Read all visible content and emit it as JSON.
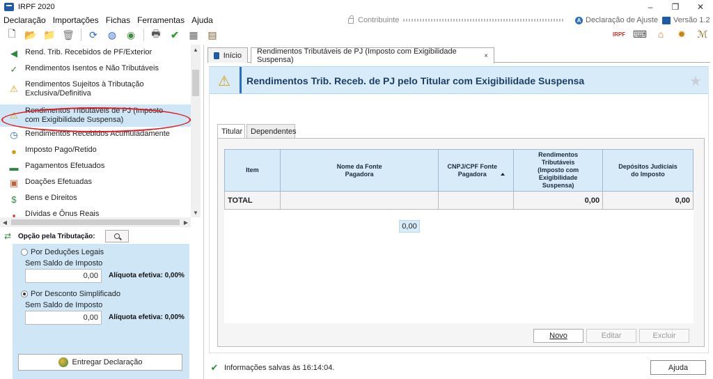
{
  "window": {
    "title": "IRPF 2020",
    "controls": {
      "minimize": "–",
      "restore": "❐",
      "close": "✕"
    }
  },
  "menu": [
    "Declaração",
    "Importações",
    "Fichas",
    "Ferramentas",
    "Ajuda"
  ],
  "header_info": {
    "contribuinte_label": "Contribuinte",
    "declaracao": "Declaração de Ajuste",
    "versao": "Versão 1.2"
  },
  "toolbar": {
    "icons": [
      "new-file-icon",
      "open-folder-icon",
      "folder-icon",
      "trash-icon",
      "globe-arrows-icon",
      "globe-search-icon",
      "globe-icon",
      "print-icon",
      "check-icon",
      "calculator-icon",
      "report-icon"
    ],
    "right_icons": [
      "irpf-icon",
      "keyboard-icon",
      "home-icon",
      "receita-seal-icon",
      "help-m-icon"
    ]
  },
  "nav": {
    "items": [
      {
        "label": "Rend. Trib. Recebidos de PF/Exterior",
        "icon": "money-arrow-icon"
      },
      {
        "label": "Rendimentos Isentos e Não Tributáveis",
        "icon": "shield-check-icon"
      },
      {
        "label": "Rendimentos Sujeitos à Tributação Exclusiva/Definitiva",
        "icon": "warning-icon"
      },
      {
        "label": "Rendimentos Tributáveis de PJ (Imposto com Exigibilidade Suspensa)",
        "icon": "money-warning-icon",
        "selected": true
      },
      {
        "label": "Rendimentos Recebidos Acumuladamente",
        "icon": "money-clock-icon"
      },
      {
        "label": "Imposto Pago/Retido",
        "icon": "coin-hand-icon"
      },
      {
        "label": "Pagamentos Efetuados",
        "icon": "banknote-icon"
      },
      {
        "label": "Doações Efetuadas",
        "icon": "donation-icon"
      },
      {
        "label": "Bens e Direitos",
        "icon": "dollar-box-icon"
      },
      {
        "label": "Dívidas e Ônus Reais",
        "icon": "debt-icon"
      }
    ]
  },
  "tributacao": {
    "label": "Opção pela Tributação:",
    "deducoes": {
      "label": "Por Deduções Legais",
      "sub": "Sem Saldo de Imposto",
      "value": "0,00",
      "aliquota": "Alíquota efetiva: 0,00%"
    },
    "simplificado": {
      "label": "Por Desconto Simplificado",
      "sub": "Sem Saldo de Imposto",
      "value": "0,00",
      "aliquota": "Alíquota efetiva: 0,00%"
    },
    "entregar": "Entregar Declaração"
  },
  "tabs": [
    {
      "label": "Início"
    },
    {
      "label": "Rendimentos Tributáveis de PJ (Imposto com Exigibilidade Suspensa)",
      "close": "×"
    }
  ],
  "page": {
    "title": "Rendimentos Trib. Receb. de PJ pelo Titular com Exigibilidade Suspensa",
    "star": "★"
  },
  "inner_tabs": [
    "Titular",
    "Dependentes"
  ],
  "grid": {
    "columns": [
      "Item",
      "Nome da Fonte Pagadora",
      "CNPJ/CPF Fonte Pagadora",
      "Rendimentos Tributáveis (Imposto com Exigibilidade Suspensa)",
      "Depósitos Judiciais do Imposto"
    ],
    "total_row": {
      "label": "TOTAL",
      "rendimentos": "0,00",
      "depositos": "0,00"
    },
    "float_value": "0,00"
  },
  "buttons": {
    "novo": "Novo",
    "editar": "Editar",
    "excluir": "Excluir",
    "ajuda": "Ajuda"
  },
  "status": {
    "message": "Informações salvas às 16:14:04."
  }
}
